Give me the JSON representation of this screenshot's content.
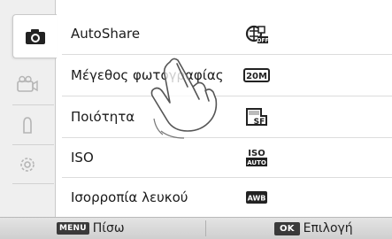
{
  "tabs": [
    {
      "name": "camera",
      "icon": "camera-icon",
      "active": true
    },
    {
      "name": "video",
      "icon": "video-camera-icon",
      "active": false
    },
    {
      "name": "user",
      "icon": "user-icon",
      "active": false
    },
    {
      "name": "settings",
      "icon": "gear-icon",
      "active": false
    }
  ],
  "menu": {
    "items": [
      {
        "label": "AutoShare",
        "icon": "autoshare-off-icon"
      },
      {
        "label": "Μέγεθος φωτογραφίας",
        "icon": "photo-size-20m-icon",
        "icon_text": "20M"
      },
      {
        "label": "Ποιότητα",
        "icon": "quality-superfine-icon",
        "icon_text": "SF"
      },
      {
        "label": "ISO",
        "icon": "iso-auto-icon",
        "icon_text": [
          "ISO",
          "AUTO"
        ]
      },
      {
        "label": "Ισορροπία λευκού",
        "icon": "white-balance-auto-icon",
        "icon_text": "AWB"
      }
    ]
  },
  "bottom_bar": {
    "back": {
      "key": "MENU",
      "label": "Πίσω"
    },
    "select": {
      "key": "OK",
      "label": "Επιλογή"
    }
  },
  "colors": {
    "rail": "#efefef",
    "text": "#1a1a1a",
    "bar": "#d8d8d8",
    "key": "#3a3a3a"
  }
}
